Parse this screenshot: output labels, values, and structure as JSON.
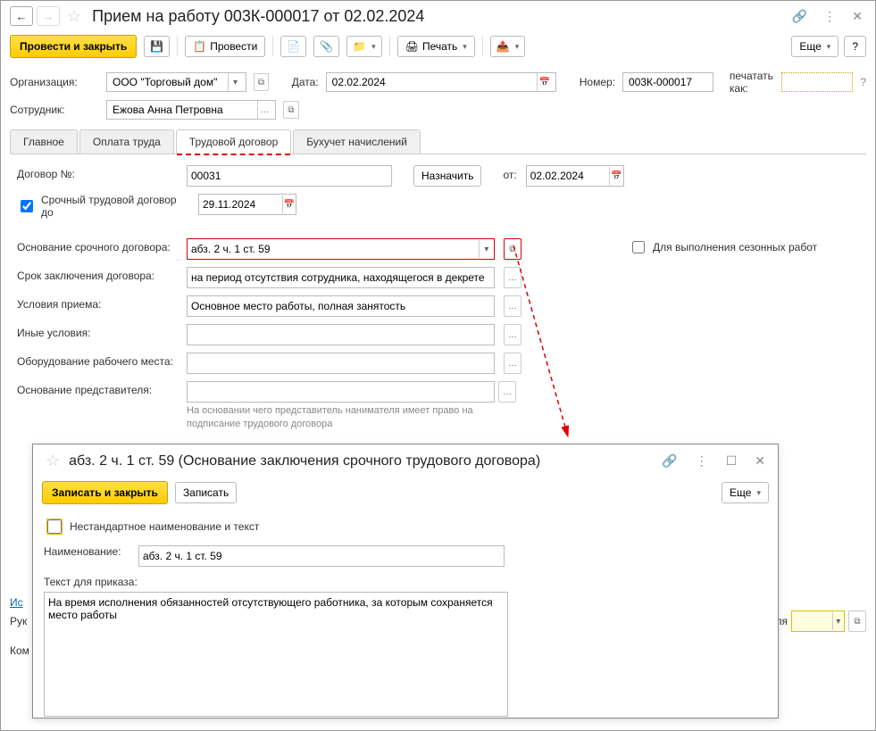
{
  "header": {
    "title": "Прием на работу 003К-000017 от 02.02.2024"
  },
  "toolbar": {
    "post_close": "Провести и закрыть",
    "post": "Провести",
    "print": "Печать",
    "more": "Еще",
    "help": "?"
  },
  "form": {
    "org_label": "Организация:",
    "org_value": "ООО \"Торговый дом\"",
    "date_label": "Дата:",
    "date_value": "02.02.2024",
    "number_label": "Номер:",
    "number_value": "003К-000017",
    "print_as_label": "печатать как:",
    "print_as_value": "",
    "employee_label": "Сотрудник:",
    "employee_value": "Ежова Анна Петровна"
  },
  "tabs": {
    "main": "Главное",
    "salary": "Оплата труда",
    "contract": "Трудовой договор",
    "accounting": "Бухучет начислений"
  },
  "contract": {
    "number_label": "Договор №:",
    "number_value": "00031",
    "assign": "Назначить",
    "from_label": "от:",
    "from_value": "02.02.2024",
    "urgent_checkbox": "Срочный трудовой договор до",
    "until_value": "29.11.2024",
    "basis_label": "Основание срочного договора:",
    "basis_value": "абз. 2 ч. 1 ст. 59",
    "seasonal_label": "Для выполнения сезонных работ",
    "term_label": "Срок заключения договора:",
    "term_value": "на период отсутствия сотрудника, находящегося в декрете",
    "conditions_label": "Условия приема:",
    "conditions_value": "Основное место работы, полная занятость",
    "other_label": "Иные условия:",
    "other_value": "",
    "equipment_label": "Оборудование рабочего места:",
    "equipment_value": "",
    "rep_basis_label": "Основание представителя:",
    "rep_basis_value": "",
    "rep_helper": "На основании чего представитель нанимателя имеет право на подписание трудового договора"
  },
  "bottom": {
    "head_label": "Рук",
    "history_label": "Ис",
    "comment_label": "Ком",
    "trailing": "ателя"
  },
  "subwindow": {
    "title": "абз. 2 ч. 1 ст. 59 (Основание заключения срочного трудового договора)",
    "save_close": "Записать и закрыть",
    "save": "Записать",
    "more": "Еще",
    "nonstd_label": "Нестандартное наименование и текст",
    "name_label": "Наименование:",
    "name_value": "абз. 2 ч. 1 ст. 59",
    "order_text_label": "Текст для приказа:",
    "order_text_value": "На время исполнения обязанностей отсутствующего работника, за которым сохраняется место работы"
  }
}
